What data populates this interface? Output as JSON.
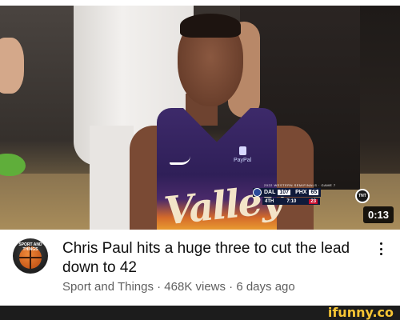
{
  "video": {
    "duration": "0:13",
    "scene": {
      "jersey_text": "Valley",
      "jersey_sponsor": "PayPal"
    },
    "scorebug": {
      "header": "2022 WESTERN SEMIFINALS · GAME 7",
      "team_away": "DAL",
      "score_away": "107",
      "team_home": "PHX",
      "score_home": "65",
      "quarter": "4TH",
      "clock": "7:10",
      "shot_clock": "23",
      "network": "TNT"
    }
  },
  "title": "Chris Paul hits a huge three to cut the lead down to 42",
  "channel": {
    "avatar_text": "SPORT AND THINGS"
  },
  "meta": "Sport and Things · 468K views · 6 days ago",
  "watermark": "ifunny.co",
  "icons": [
    "more-vert-icon"
  ]
}
